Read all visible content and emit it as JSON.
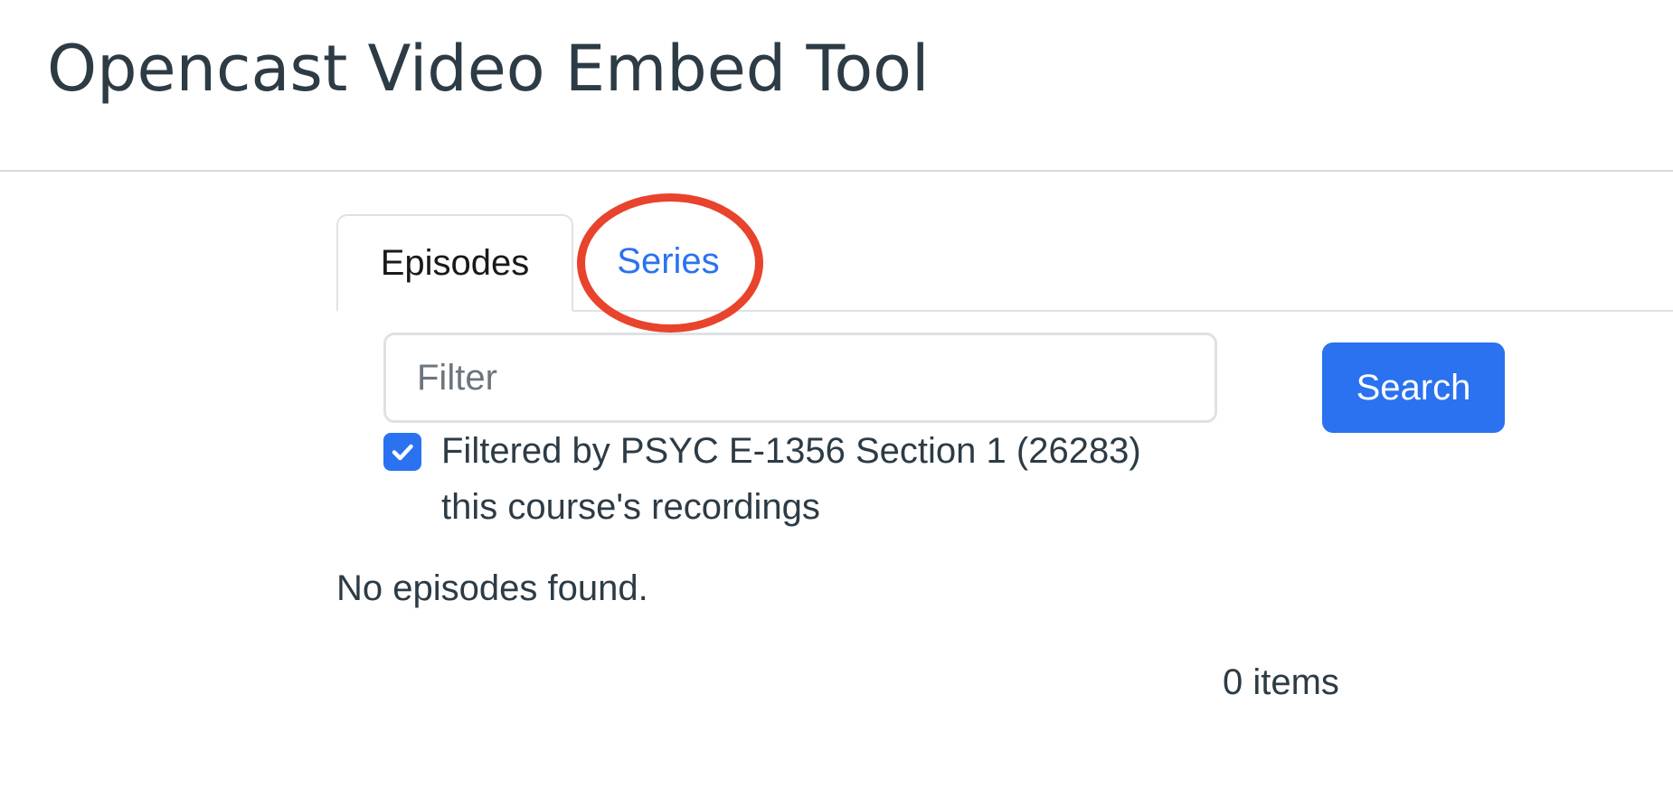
{
  "app": {
    "title": "Opencast Video Embed Tool"
  },
  "tabs": {
    "items": [
      {
        "label": "Episodes",
        "active": true
      },
      {
        "label": "Series",
        "active": false,
        "highlighted": true
      }
    ]
  },
  "search": {
    "placeholder": "Filter",
    "value": "",
    "button_label": "Search"
  },
  "course_filter": {
    "checked": true,
    "label_line1": "Filtered by PSYC E-1356 Section 1 (26283)",
    "label_line2": "this course's recordings"
  },
  "results": {
    "empty_message": "No episodes found.",
    "count_label": "0 items"
  },
  "colors": {
    "accent": "#2b72f0",
    "title_text": "#2d3b45",
    "highlight_ring": "#e8432c",
    "divider": "#d7dadd"
  },
  "icons": {
    "checkbox": "check-icon"
  }
}
